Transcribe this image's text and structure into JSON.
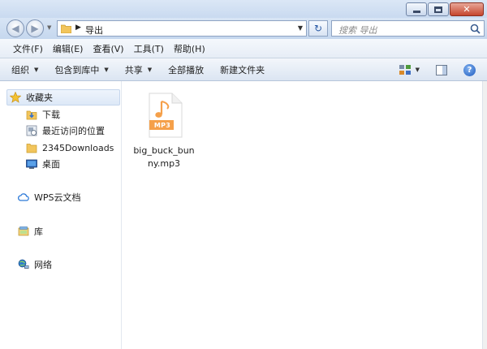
{
  "window": {
    "minimize_label": "_",
    "maximize_label": "□",
    "close_label": "✕"
  },
  "address": {
    "folder": "导出",
    "separator": "▶",
    "search_placeholder": "搜索 导出"
  },
  "menu": [
    "文件(F)",
    "编辑(E)",
    "查看(V)",
    "工具(T)",
    "帮助(H)"
  ],
  "commands": [
    {
      "label": "组织",
      "has_menu": true
    },
    {
      "label": "包含到库中",
      "has_menu": true
    },
    {
      "label": "共享",
      "has_menu": true
    },
    {
      "label": "全部播放",
      "has_menu": false
    },
    {
      "label": "新建文件夹",
      "has_menu": false
    }
  ],
  "nav": {
    "favorites": "收藏夹",
    "fav_items": [
      "下载",
      "最近访问的位置",
      "2345Downloads",
      "桌面"
    ],
    "wps": "WPS云文档",
    "library": "库",
    "network": "网络"
  },
  "file": {
    "name": "big_buck_bunny.mp3",
    "badge": "MP3",
    "icon": "mp3-file-icon"
  },
  "colors": {
    "accent": "#f5a04a",
    "folder": "#f2c55c",
    "title_bar": "#c9daf0"
  }
}
